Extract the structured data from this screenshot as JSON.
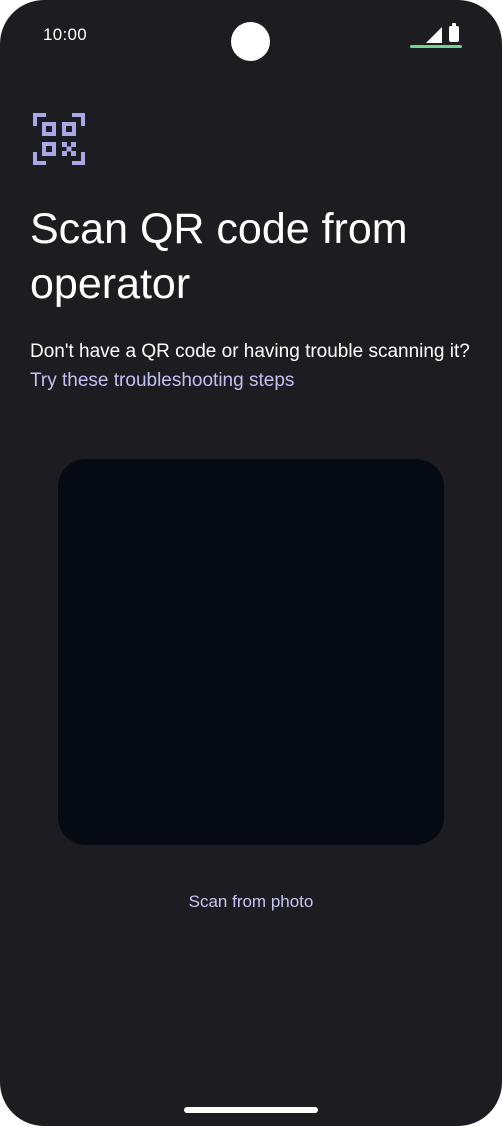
{
  "status_bar": {
    "time": "10:00",
    "icons": [
      "signal-icon",
      "battery-icon"
    ],
    "charging": true
  },
  "header": {
    "icon": "qr-code-scanner-icon",
    "title": "Scan QR code from operator"
  },
  "description": {
    "text": "Don't have a QR code or having trouble scanning it?",
    "link_label": "Try these troubleshooting steps"
  },
  "camera": {
    "state": "preview"
  },
  "actions": {
    "scan_from_photo_label": "Scan from photo"
  },
  "colors": {
    "background": "#1d1c21",
    "accent": "#c4c0f4",
    "icon_accent": "#aaa6e8",
    "preview": "#060a12",
    "charge_indicator": "#6fd68a"
  }
}
